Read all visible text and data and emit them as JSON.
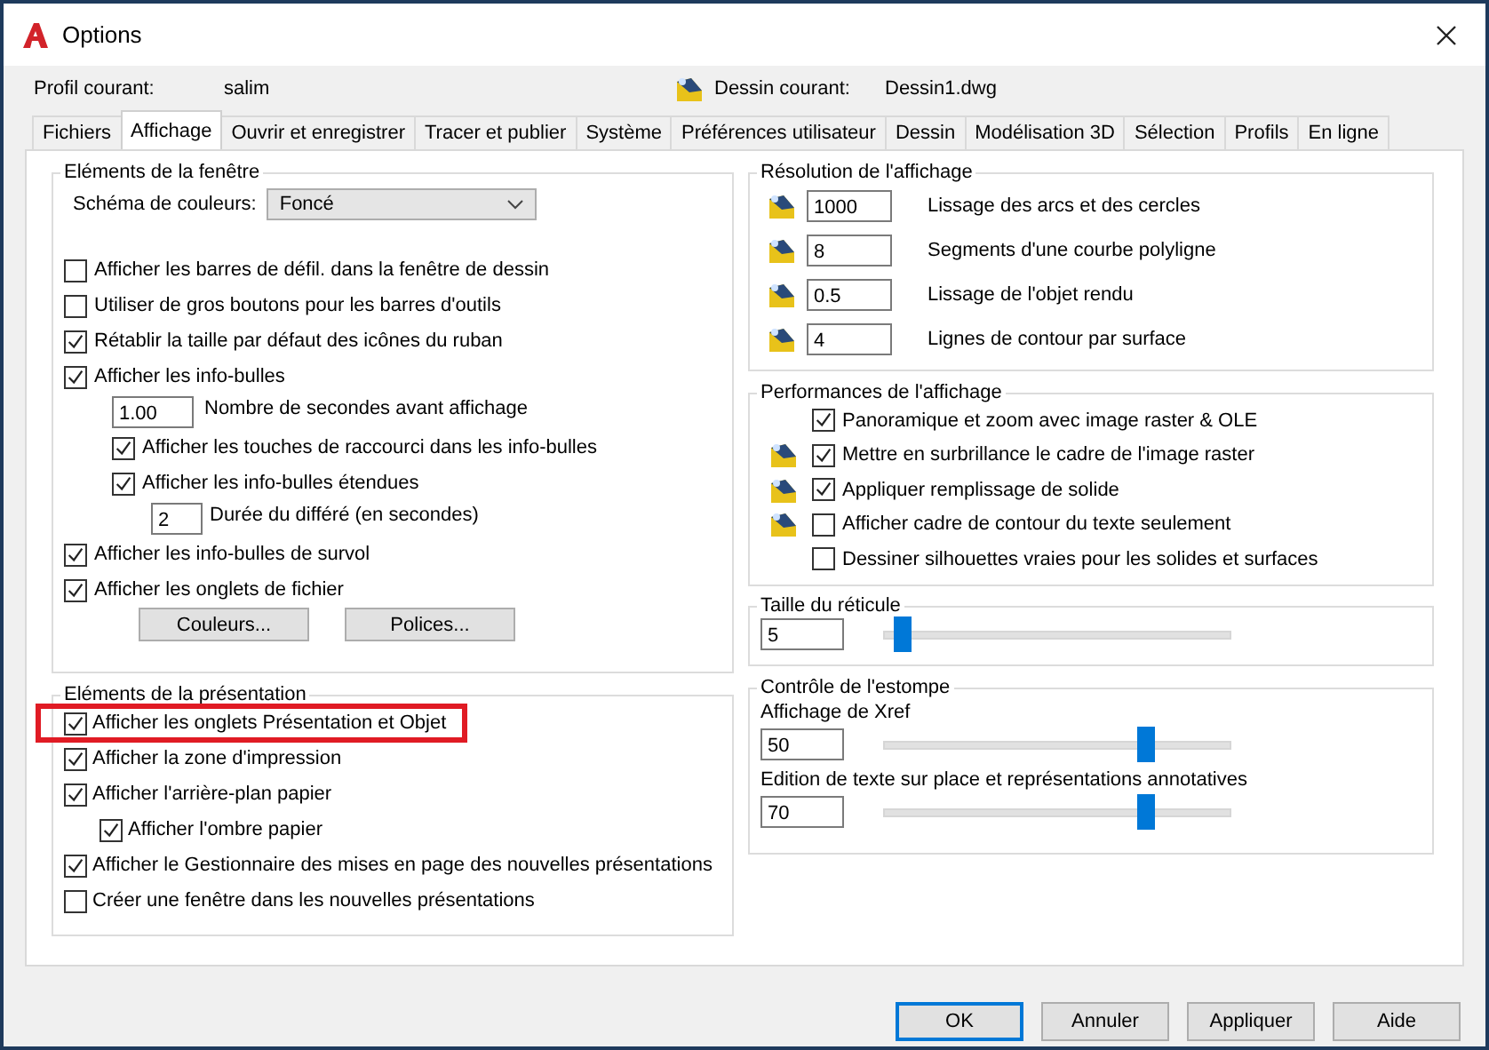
{
  "window": {
    "title": "Options"
  },
  "profile": {
    "label": "Profil courant:",
    "value": "salim"
  },
  "drawing": {
    "label": "Dessin courant:",
    "value": "Dessin1.dwg"
  },
  "tabs": [
    {
      "label": "Fichiers",
      "selected": false
    },
    {
      "label": "Affichage",
      "selected": true
    },
    {
      "label": "Ouvrir et enregistrer",
      "selected": false
    },
    {
      "label": "Tracer et publier",
      "selected": false
    },
    {
      "label": "Système",
      "selected": false
    },
    {
      "label": "Préférences utilisateur",
      "selected": false
    },
    {
      "label": "Dessin",
      "selected": false
    },
    {
      "label": "Modélisation 3D",
      "selected": false
    },
    {
      "label": "Sélection",
      "selected": false
    },
    {
      "label": "Profils",
      "selected": false
    },
    {
      "label": "En ligne",
      "selected": false
    }
  ],
  "window_elements": {
    "title": "Eléments de la fenêtre",
    "color_scheme": {
      "label": "Schéma de couleurs:",
      "value": "Foncé"
    },
    "items": [
      {
        "kind": "checkbox",
        "label": "Afficher les barres de défil. dans la fenêtre de dessin",
        "checked": false
      },
      {
        "kind": "checkbox",
        "label": "Utiliser de gros boutons pour les barres d'outils",
        "checked": false
      },
      {
        "kind": "checkbox",
        "label": "Rétablir la taille par défaut des icônes du ruban",
        "checked": true
      },
      {
        "kind": "checkbox",
        "label": "Afficher les info-bulles",
        "checked": true,
        "children": [
          {
            "kind": "field",
            "value": "1.00",
            "label": "Nombre de secondes avant affichage"
          },
          {
            "kind": "checkbox",
            "label": "Afficher les touches de raccourci dans les info-bulles",
            "checked": true
          },
          {
            "kind": "checkbox",
            "label": "Afficher les info-bulles étendues",
            "checked": true,
            "children": [
              {
                "kind": "field",
                "value": "2",
                "label": "Durée du différé (en secondes)"
              }
            ]
          }
        ]
      },
      {
        "kind": "checkbox",
        "label": "Afficher les info-bulles de survol",
        "checked": true
      },
      {
        "kind": "checkbox",
        "label": "Afficher les onglets de fichier",
        "checked": true
      }
    ],
    "buttons": [
      "Couleurs...",
      "Polices..."
    ]
  },
  "layout_elements": {
    "title": "Eléments de la présentation",
    "items": [
      {
        "label": "Afficher les onglets Présentation et Objet",
        "checked": true,
        "highlighted": true
      },
      {
        "label": "Afficher la zone d'impression",
        "checked": true,
        "highlighted": false
      },
      {
        "label": "Afficher l'arrière-plan papier",
        "checked": true,
        "highlighted": false,
        "children": [
          {
            "label": "Afficher l'ombre papier",
            "checked": true
          }
        ]
      },
      {
        "label": "Afficher le Gestionnaire des mises en page des nouvelles présentations",
        "checked": true,
        "highlighted": false
      },
      {
        "label": "Créer une fenêtre dans les nouvelles présentations",
        "checked": false,
        "highlighted": false
      }
    ]
  },
  "resolution": {
    "title": "Résolution de l'affichage",
    "rows": [
      {
        "value": "1000",
        "label": "Lissage des arcs et des cercles"
      },
      {
        "value": "8",
        "label": "Segments d'une courbe polyligne"
      },
      {
        "value": "0.5",
        "label": "Lissage de l'objet rendu"
      },
      {
        "value": "4",
        "label": "Lignes de contour par surface"
      }
    ]
  },
  "performance": {
    "title": "Performances de l'affichage",
    "items": [
      {
        "label": "Panoramique et zoom avec image raster & OLE",
        "checked": true,
        "drawing_icon": false
      },
      {
        "label": "Mettre en surbrillance le cadre de l'image raster",
        "checked": true,
        "drawing_icon": true
      },
      {
        "label": "Appliquer remplissage de solide",
        "checked": true,
        "drawing_icon": true
      },
      {
        "label": "Afficher cadre de contour du texte seulement",
        "checked": false,
        "drawing_icon": true
      },
      {
        "label": "Dessiner silhouettes vraies pour les solides et surfaces",
        "checked": false,
        "drawing_icon": false
      }
    ]
  },
  "crosshair": {
    "title": "Taille du réticule",
    "value": "5",
    "level": 0.05
  },
  "fade": {
    "title": "Contrôle de l'estompe",
    "sliders": [
      {
        "label": "Affichage de Xref",
        "value": "50",
        "level": 0.76
      },
      {
        "label": "Edition de texte sur place et représentations annotatives",
        "value": "70",
        "level": 0.76
      }
    ]
  },
  "buttons": [
    {
      "label": "OK",
      "default": true
    },
    {
      "label": "Annuler",
      "default": false
    },
    {
      "label": "Appliquer",
      "default": false
    },
    {
      "label": "Aide",
      "default": false
    }
  ]
}
